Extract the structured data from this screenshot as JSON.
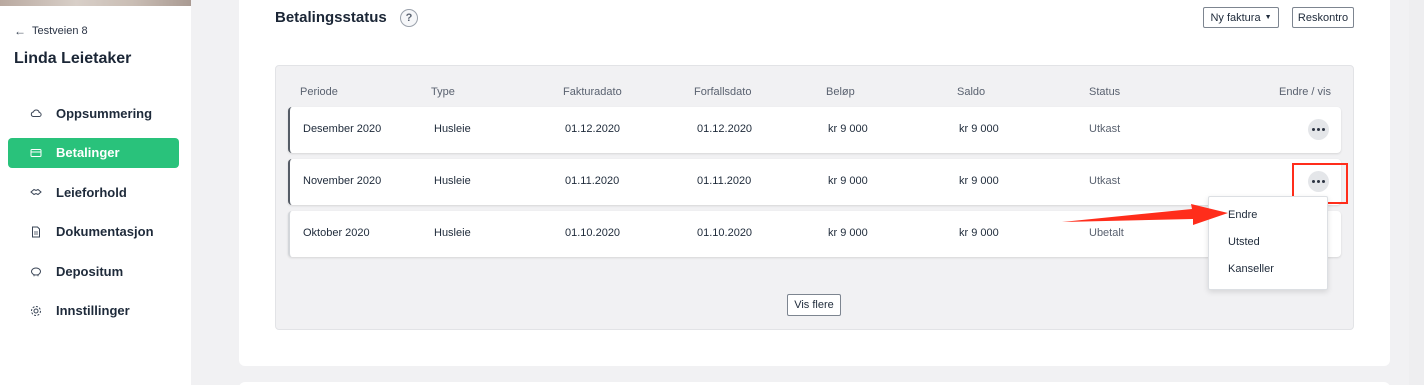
{
  "sidebar": {
    "back_label": "Testveien 8",
    "tenant_name": "Linda Leietaker",
    "items": [
      {
        "label": "Oppsummering",
        "icon": "cloud-icon",
        "active": false
      },
      {
        "label": "Betalinger",
        "icon": "card-icon",
        "active": true
      },
      {
        "label": "Leieforhold",
        "icon": "handshake-icon",
        "active": false
      },
      {
        "label": "Dokumentasjon",
        "icon": "document-icon",
        "active": false
      },
      {
        "label": "Depositum",
        "icon": "piggybank-icon",
        "active": false
      },
      {
        "label": "Innstillinger",
        "icon": "gear-icon",
        "active": false
      }
    ]
  },
  "main": {
    "title": "Betalingsstatus",
    "help": "?",
    "new_invoice_label": "Ny faktura",
    "ledger_label": "Reskontro",
    "show_more_label": "Vis flere"
  },
  "table": {
    "headers": [
      "Periode",
      "Type",
      "Fakturadato",
      "Forfallsdato",
      "Beløp",
      "Saldo",
      "Status",
      "Endre / vis"
    ],
    "rows": [
      [
        "Desember 2020",
        "Husleie",
        "01.12.2020",
        "01.12.2020",
        "kr 9 000",
        "kr 9 000",
        "Utkast"
      ],
      [
        "November 2020",
        "Husleie",
        "01.11.2020",
        "01.11.2020",
        "kr 9 000",
        "kr 9 000",
        "Utkast"
      ],
      [
        "Oktober 2020",
        "Husleie",
        "01.10.2020",
        "01.10.2020",
        "kr 9 000",
        "kr 9 000",
        "Ubetalt"
      ]
    ]
  },
  "menu": {
    "items": [
      "Endre",
      "Utsted",
      "Kanseller"
    ]
  },
  "colors": {
    "accent": "#29c27b",
    "annotation": "#ff2d1b"
  }
}
